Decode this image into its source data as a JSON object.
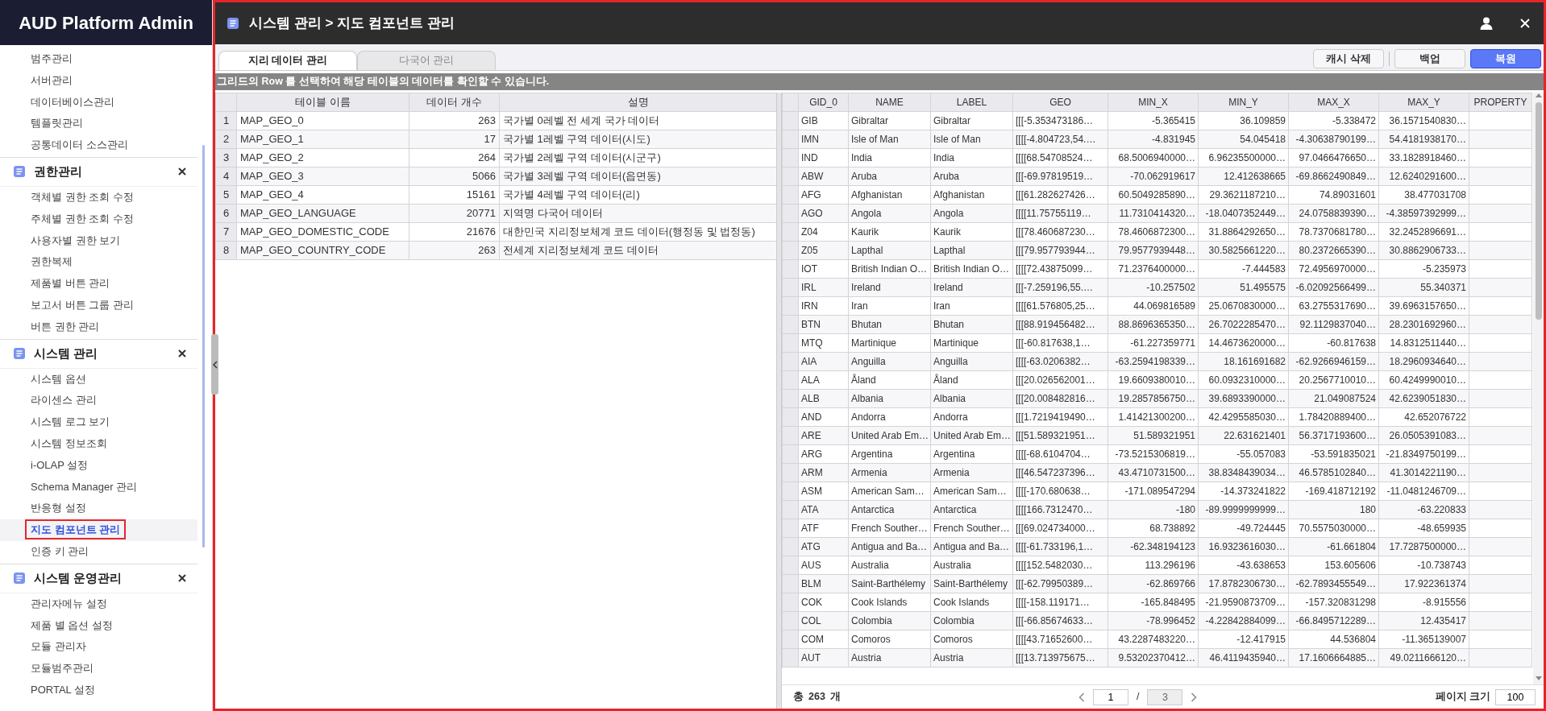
{
  "sidebar": {
    "title": "AUD Platform Admin",
    "groups": [
      {
        "items": [
          {
            "label": "범주관리",
            "selected": false
          },
          {
            "label": "서버관리",
            "selected": false
          },
          {
            "label": "데이터베이스관리",
            "selected": false
          },
          {
            "label": "템플릿관리",
            "selected": false
          },
          {
            "label": "공통데이터 소스관리",
            "selected": false
          }
        ]
      },
      {
        "title": "권한관리",
        "items": [
          {
            "label": "객체별 권한 조회 수정",
            "selected": false
          },
          {
            "label": "주체별 권한 조회 수정",
            "selected": false
          },
          {
            "label": "사용자별 권한 보기",
            "selected": false
          },
          {
            "label": "권한복제",
            "selected": false
          },
          {
            "label": "제품별 버튼 관리",
            "selected": false
          },
          {
            "label": "보고서 버튼 그룹 관리",
            "selected": false
          },
          {
            "label": "버튼 권한 관리",
            "selected": false
          }
        ]
      },
      {
        "title": "시스템 관리",
        "items": [
          {
            "label": "시스템 옵션",
            "selected": false
          },
          {
            "label": "라이센스 관리",
            "selected": false
          },
          {
            "label": "시스템 로그 보기",
            "selected": false
          },
          {
            "label": "시스템 정보조회",
            "selected": false
          },
          {
            "label": "i-OLAP 설정",
            "selected": false
          },
          {
            "label": "Schema Manager 관리",
            "selected": false
          },
          {
            "label": "반응형 설정",
            "selected": false
          },
          {
            "label": "지도 컴포넌트 관리",
            "selected": true
          },
          {
            "label": "인증 키 관리",
            "selected": false
          }
        ]
      },
      {
        "title": "시스템 운영관리",
        "items": [
          {
            "label": "관리자메뉴 설정",
            "selected": false
          },
          {
            "label": "제품 별 옵션 설정",
            "selected": false
          },
          {
            "label": "모듈 관리자",
            "selected": false
          },
          {
            "label": "모듈범주관리",
            "selected": false
          },
          {
            "label": "PORTAL 설정",
            "selected": false
          }
        ]
      }
    ]
  },
  "header": {
    "title": "시스템 관리 > 지도 컴포넌트 관리"
  },
  "tabs": [
    {
      "label": "지리 데이터 관리",
      "selected": true
    },
    {
      "label": "다국어 관리",
      "selected": false
    }
  ],
  "button_groups": [
    [
      {
        "label": "캐시 삭제",
        "kind": "default"
      }
    ],
    [
      {
        "label": "백업",
        "kind": "default"
      },
      {
        "label": "복원",
        "kind": "primary"
      }
    ]
  ],
  "notice": "그리드의 Row 를 선택하여 해당 테이블의 데이터를 확인할 수 있습니다.",
  "table_grid": {
    "columns": [
      "",
      "테이블 이름",
      "데이터 개수",
      "설명"
    ],
    "rows": [
      [
        "1",
        "MAP_GEO_0",
        "263",
        "국가별 0레벨 전 세계 국가 데이터"
      ],
      [
        "2",
        "MAP_GEO_1",
        "17",
        "국가별 1레벨 구역 데이터(시도)"
      ],
      [
        "3",
        "MAP_GEO_2",
        "264",
        "국가별 2레벨 구역 데이터(시군구)"
      ],
      [
        "4",
        "MAP_GEO_3",
        "5066",
        "국가별 3레벨 구역 데이터(읍면동)"
      ],
      [
        "5",
        "MAP_GEO_4",
        "15161",
        "국가별 4레벨 구역 데이터(리)"
      ],
      [
        "6",
        "MAP_GEO_LANGUAGE",
        "20771",
        "지역명 다국어 데이터"
      ],
      [
        "7",
        "MAP_GEO_DOMESTIC_CODE",
        "21676",
        "대한민국 지리정보체계 코드 데이터(행정동 및 법정동)"
      ],
      [
        "8",
        "MAP_GEO_COUNTRY_CODE",
        "263",
        "전세계 지리정보체계 코드 데이터"
      ]
    ]
  },
  "data_grid": {
    "columns": [
      "GID_0",
      "NAME",
      "LABEL",
      "GEO",
      "MIN_X",
      "MIN_Y",
      "MAX_X",
      "MAX_Y",
      "PROPERTY"
    ],
    "rows": [
      [
        "GIB",
        "Gibraltar",
        "Gibraltar",
        "[[[-5.353473186…",
        "-5.365415",
        "36.109859",
        "-5.338472",
        "36.1571540830…"
      ],
      [
        "IMN",
        "Isle of Man",
        "Isle of Man",
        "[[[[-4.804723,54.…",
        "-4.831945",
        "54.045418",
        "-4.30638790199…",
        "54.4181938170…"
      ],
      [
        "IND",
        "India",
        "India",
        "[[[[68.54708524…",
        "68.5006940000…",
        "6.96235500000…",
        "97.0466476650…",
        "33.1828918460…"
      ],
      [
        "ABW",
        "Aruba",
        "Aruba",
        "[[[-69.97819519…",
        "-70.062919617",
        "12.412638665",
        "-69.8662490849…",
        "12.6240291600…"
      ],
      [
        "AFG",
        "Afghanistan",
        "Afghanistan",
        "[[[61.282627426…",
        "60.5049285890…",
        "29.3621187210…",
        "74.89031601",
        "38.477031708"
      ],
      [
        "AGO",
        "Angola",
        "Angola",
        "[[[[11.75755119…",
        "11.7310414320…",
        "-18.0407352449…",
        "24.0758839390…",
        "-4.38597392999…"
      ],
      [
        "Z04",
        "Kaurik",
        "Kaurik",
        "[[[78.460687230…",
        "78.4606872300…",
        "31.8864292650…",
        "78.7370681780…",
        "32.2452896691…"
      ],
      [
        "Z05",
        "Lapthal",
        "Lapthal",
        "[[[79.957793944…",
        "79.9577939448…",
        "30.5825661220…",
        "80.2372665390…",
        "30.8862906733…"
      ],
      [
        "IOT",
        "British Indian O…",
        "British Indian O…",
        "[[[[72.43875099…",
        "71.2376400000…",
        "-7.444583",
        "72.4956970000…",
        "-5.235973"
      ],
      [
        "IRL",
        "Ireland",
        "Ireland",
        "[[[-7.259196,55.…",
        "-10.257502",
        "51.495575",
        "-6.02092566499…",
        "55.340371"
      ],
      [
        "IRN",
        "Iran",
        "Iran",
        "[[[[61.576805,25…",
        "44.069816589",
        "25.0670830000…",
        "63.2755317690…",
        "39.6963157650…"
      ],
      [
        "BTN",
        "Bhutan",
        "Bhutan",
        "[[[88.919456482…",
        "88.8696365350…",
        "26.7022285470…",
        "92.1129837040…",
        "28.2301692960…"
      ],
      [
        "MTQ",
        "Martinique",
        "Martinique",
        "[[[-60.817638,1…",
        "-61.227359771",
        "14.4673620000…",
        "-60.817638",
        "14.8312511440…"
      ],
      [
        "AIA",
        "Anguilla",
        "Anguilla",
        "[[[[-63.0206382…",
        "-63.2594198339…",
        "18.161691682",
        "-62.9266946159…",
        "18.2960934640…"
      ],
      [
        "ALA",
        "Åland",
        "Åland",
        "[[[20.026562001…",
        "19.6609380010…",
        "60.0932310000…",
        "20.2567710010…",
        "60.4249990010…"
      ],
      [
        "ALB",
        "Albania",
        "Albania",
        "[[[20.008482816…",
        "19.2857856750…",
        "39.6893390000…",
        "21.049087524",
        "42.6239051830…"
      ],
      [
        "AND",
        "Andorra",
        "Andorra",
        "[[[1.7219419490…",
        "1.41421300200…",
        "42.4295585030…",
        "1.78420889400…",
        "42.652076722"
      ],
      [
        "ARE",
        "United Arab Em…",
        "United Arab Em…",
        "[[[51.589321951…",
        "51.589321951",
        "22.631621401",
        "56.3717193600…",
        "26.0505391083…"
      ],
      [
        "ARG",
        "Argentina",
        "Argentina",
        "[[[[-68.6104704…",
        "-73.5215306819…",
        "-55.057083",
        "-53.591835021",
        "-21.8349750199…"
      ],
      [
        "ARM",
        "Armenia",
        "Armenia",
        "[[[46.547237396…",
        "43.4710731500…",
        "38.8348439034…",
        "46.5785102840…",
        "41.3014221190…"
      ],
      [
        "ASM",
        "American Sam…",
        "American Sam…",
        "[[[[-170.680638…",
        "-171.089547294",
        "-14.373241822",
        "-169.418712192",
        "-11.0481246709…"
      ],
      [
        "ATA",
        "Antarctica",
        "Antarctica",
        "[[[[166.7312470…",
        "-180",
        "-89.9999999999…",
        "180",
        "-63.220833"
      ],
      [
        "ATF",
        "French Souther…",
        "French Souther…",
        "[[[69.024734000…",
        "68.738892",
        "-49.724445",
        "70.5575030000…",
        "-48.659935"
      ],
      [
        "ATG",
        "Antigua and Ba…",
        "Antigua and Ba…",
        "[[[[-61.733196,1…",
        "-62.348194123",
        "16.9323616030…",
        "-61.661804",
        "17.7287500000…"
      ],
      [
        "AUS",
        "Australia",
        "Australia",
        "[[[[152.5482030…",
        "113.296196",
        "-43.638653",
        "153.605606",
        "-10.738743"
      ],
      [
        "BLM",
        "Saint-Barthélemy",
        "Saint-Barthélemy",
        "[[[-62.79950389…",
        "-62.869766",
        "17.8782306730…",
        "-62.7893455549…",
        "17.922361374"
      ],
      [
        "COK",
        "Cook Islands",
        "Cook Islands",
        "[[[[-158.119171…",
        "-165.848495",
        "-21.9590873709…",
        "-157.320831298",
        "-8.915556"
      ],
      [
        "COL",
        "Colombia",
        "Colombia",
        "[[[-66.85674633…",
        "-78.996452",
        "-4.22842884099…",
        "-66.8495712289…",
        "12.435417"
      ],
      [
        "COM",
        "Comoros",
        "Comoros",
        "[[[[43.71652600…",
        "43.2287483220…",
        "-12.417915",
        "44.536804",
        "-11.365139007"
      ],
      [
        "AUT",
        "Austria",
        "Austria",
        "[[[13.713975675…",
        "9.53202370412…",
        "46.4119435940…",
        "17.1606664885…",
        "49.0211666120…"
      ]
    ]
  },
  "footer": {
    "total_label": "총",
    "total": "263",
    "unit": "개",
    "page": "1",
    "separator": "/",
    "pages": "3",
    "page_size_label": "페이지 크기",
    "page_size": "100"
  }
}
